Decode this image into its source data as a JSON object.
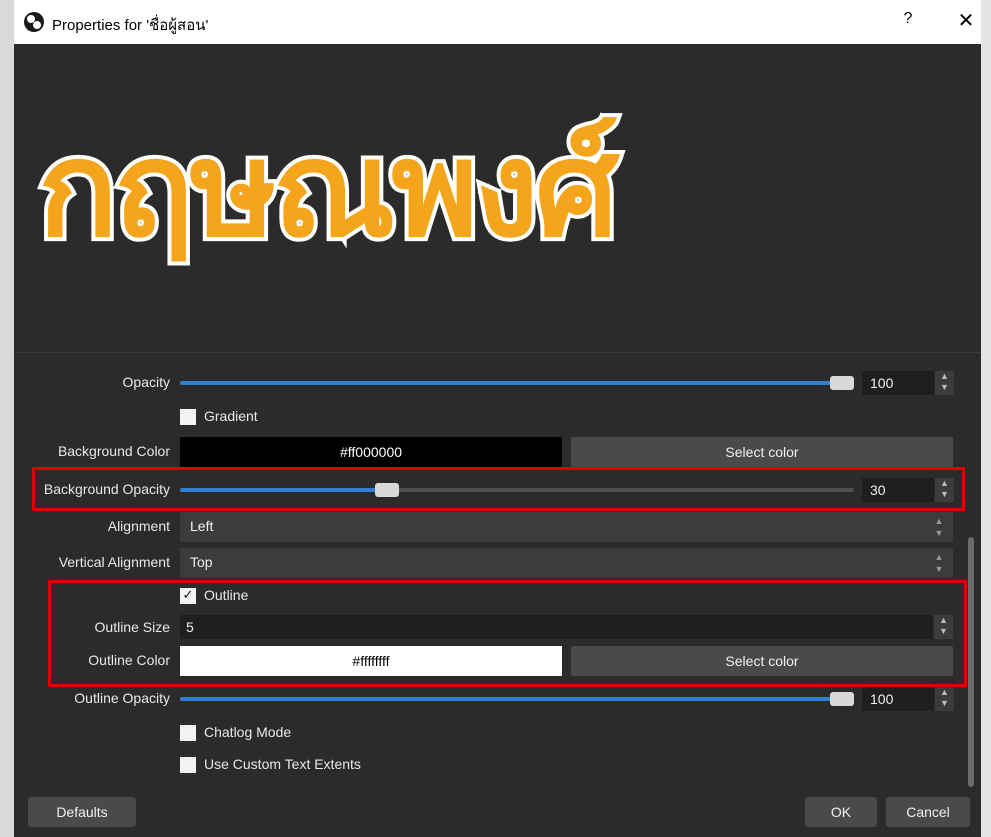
{
  "window": {
    "title": "Properties for 'ชื่อผู้สอน'",
    "help_label": "?",
    "close_label": "✕"
  },
  "preview": {
    "text": "กฤษณพงศ์",
    "text_color": "#f5a51c",
    "outline_color": "#ffffff"
  },
  "form": {
    "opacity": {
      "label": "Opacity",
      "value": "100",
      "level": 1.0
    },
    "gradient": {
      "label": "Gradient",
      "checked": false
    },
    "background_color": {
      "label": "Background Color",
      "value": "#ff000000",
      "button": "Select color"
    },
    "background_opacity": {
      "label": "Background Opacity",
      "value": "30",
      "level": 0.3
    },
    "alignment": {
      "label": "Alignment",
      "value": "Left"
    },
    "vertical_alignment": {
      "label": "Vertical Alignment",
      "value": "Top"
    },
    "outline": {
      "label": "Outline",
      "checked": true,
      "check_glyph": "✓"
    },
    "outline_size": {
      "label": "Outline Size",
      "value": "5"
    },
    "outline_color": {
      "label": "Outline Color",
      "value": "#ffffffff",
      "button": "Select color"
    },
    "outline_opacity": {
      "label": "Outline Opacity",
      "value": "100",
      "level": 1.0
    },
    "chatlog_mode": {
      "label": "Chatlog Mode",
      "checked": false
    },
    "custom_text_extents": {
      "label": "Use Custom Text Extents",
      "checked": false
    }
  },
  "footer": {
    "defaults": "Defaults",
    "ok": "OK",
    "cancel": "Cancel"
  },
  "colors": {
    "highlight": "#e00000",
    "accent": "#2f7fd6"
  }
}
